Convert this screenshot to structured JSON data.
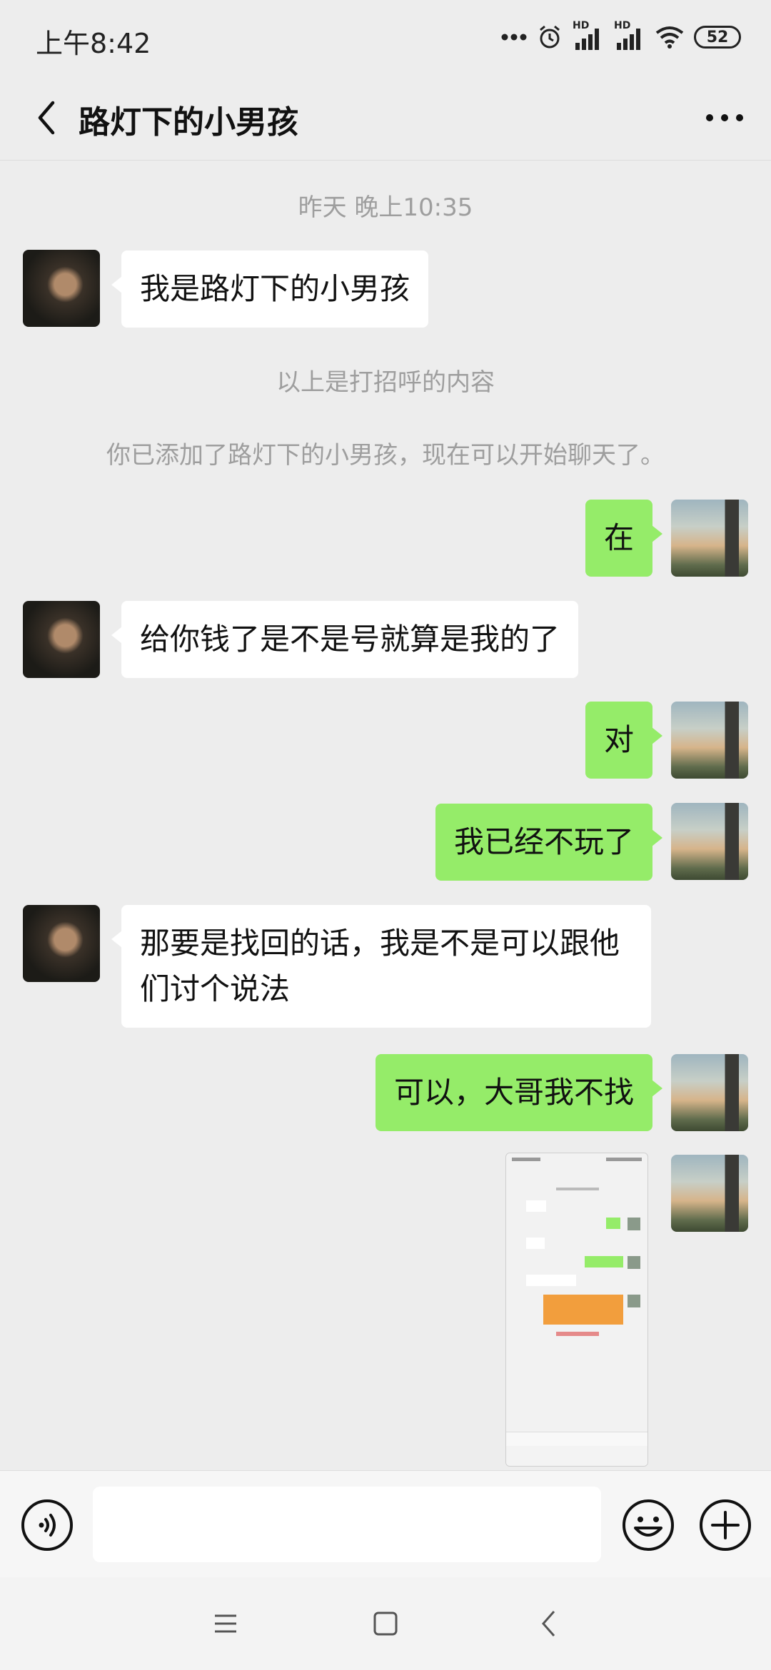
{
  "status_bar": {
    "time": "上午8:42",
    "battery": "52",
    "signal_labels": [
      "HD",
      "HD"
    ]
  },
  "header": {
    "title": "路灯下的小男孩"
  },
  "chat": {
    "timestamp": "昨天 晚上10:35",
    "greeting_note": "以上是打招呼的内容",
    "added_note": "你已添加了路灯下的小男孩，现在可以开始聊天了。",
    "messages": [
      {
        "side": "left",
        "text": "我是路灯下的小男孩"
      },
      {
        "side": "right",
        "text": "在"
      },
      {
        "side": "left",
        "text": "给你钱了是不是号就算是我的了"
      },
      {
        "side": "right",
        "text": "对"
      },
      {
        "side": "right",
        "text": "我已经不玩了"
      },
      {
        "side": "left",
        "text": "那要是找回的话，我是不是可以跟他们讨个说法"
      },
      {
        "side": "right",
        "text": "可以，大哥我不找"
      }
    ]
  },
  "input": {
    "value": "",
    "placeholder": ""
  },
  "icons": {
    "back": "chevron-left-icon",
    "more": "more-dots-icon",
    "voice": "voice-icon",
    "emoji": "emoji-icon",
    "plus": "plus-icon",
    "nav_menu": "menu-icon",
    "nav_home": "home-icon",
    "nav_back": "nav-back-icon"
  },
  "colors": {
    "background": "#ededed",
    "sent_bubble": "#95ec69",
    "received_bubble": "#ffffff",
    "system_text": "#9e9e9e"
  }
}
